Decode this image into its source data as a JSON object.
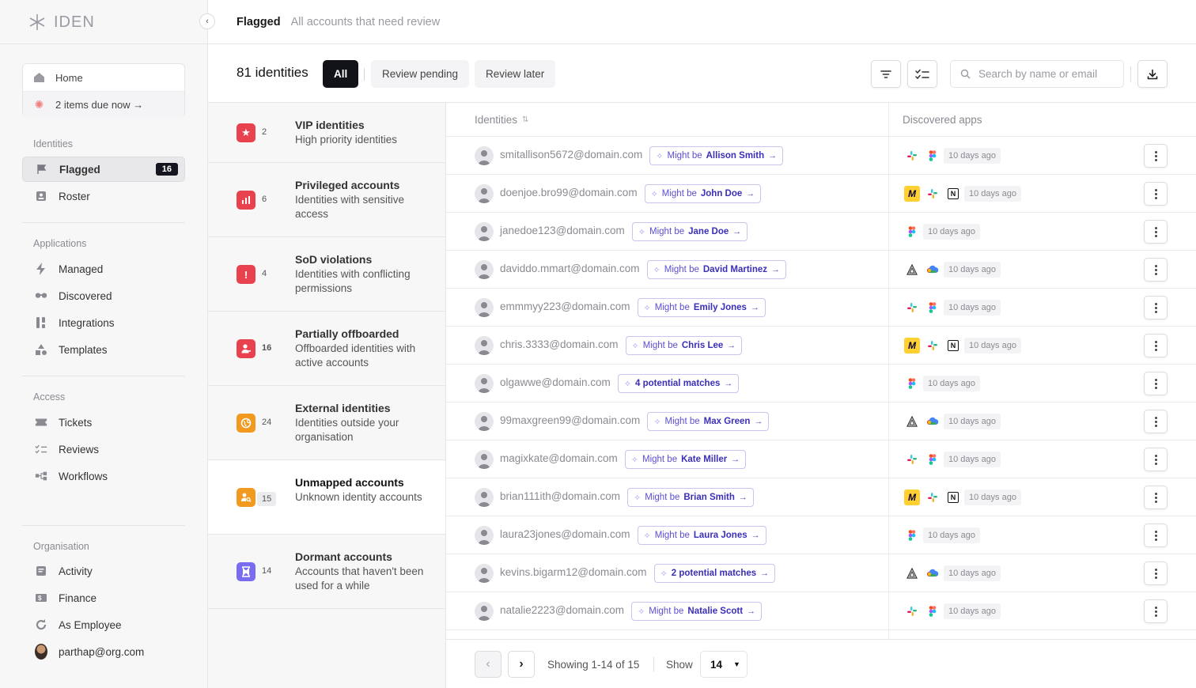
{
  "brand": {
    "name": "IDEN"
  },
  "header": {
    "title": "Flagged",
    "subtitle": "All accounts that need review"
  },
  "quick": {
    "home": "Home",
    "due": "2 items due now →"
  },
  "sidebar": {
    "sections": [
      {
        "label": "Identities",
        "items": [
          {
            "label": "Flagged",
            "badge": "16",
            "icon": "flag-icon"
          },
          {
            "label": "Roster",
            "icon": "roster-icon"
          }
        ]
      },
      {
        "label": "Applications",
        "items": [
          {
            "label": "Managed",
            "icon": "bolt-icon"
          },
          {
            "label": "Discovered",
            "icon": "glasses-icon"
          },
          {
            "label": "Integrations",
            "icon": "integrations-icon"
          },
          {
            "label": "Templates",
            "icon": "shapes-icon"
          }
        ]
      },
      {
        "label": "Access",
        "items": [
          {
            "label": "Tickets",
            "icon": "ticket-icon"
          },
          {
            "label": "Reviews",
            "icon": "checklist-icon"
          },
          {
            "label": "Workflows",
            "icon": "workflow-icon"
          }
        ]
      },
      {
        "label": "Organisation",
        "items": [
          {
            "label": "Activity",
            "icon": "activity-icon"
          },
          {
            "label": "Finance",
            "icon": "finance-icon"
          },
          {
            "label": "As Employee",
            "icon": "refresh-icon"
          },
          {
            "label": "parthap@org.com",
            "icon": "avatar"
          }
        ]
      }
    ]
  },
  "toolbar": {
    "count": "81 identities",
    "tabs": [
      {
        "label": "All"
      },
      {
        "label": "Review pending"
      },
      {
        "label": "Review later"
      }
    ],
    "search_placeholder": "Search by name or email"
  },
  "categories": [
    {
      "count": "2",
      "title": "VIP identities",
      "desc": "High priority identities",
      "color": "#e8424f",
      "icon": "star-icon"
    },
    {
      "count": "6",
      "title": "Privileged accounts",
      "desc": "Identities with sensitive access",
      "color": "#e8424f",
      "icon": "bar-chart-icon"
    },
    {
      "count": "4",
      "title": "SoD violations",
      "desc": "Identities with conflicting permissions",
      "color": "#e8424f",
      "icon": "exclamation-icon"
    },
    {
      "count": "16",
      "title": "Partially offboarded",
      "desc": "Offboarded identities with active accounts",
      "color": "#e8424f",
      "icon": "user-minus-icon"
    },
    {
      "count": "24",
      "title": "External identities",
      "desc": "Identities outside your organisation",
      "color": "#f29a1f",
      "icon": "globe-icon"
    },
    {
      "count": "15",
      "title": "Unmapped accounts",
      "desc": "Unknown identity accounts",
      "color": "#f29a1f",
      "icon": "user-search-icon"
    },
    {
      "count": "14",
      "title": "Dormant accounts",
      "desc": "Accounts that haven't been used for a while",
      "color": "#7a6cf0",
      "icon": "hourglass-icon"
    }
  ],
  "table": {
    "col_identities": "Identities",
    "col_apps": "Discovered apps",
    "rows": [
      {
        "email": "smitallison5672@domain.com",
        "prefix": "Might be",
        "name": "Allison Smith",
        "apps": [
          "slack",
          "figma"
        ],
        "ago": "10 days ago"
      },
      {
        "email": "doenjoe.bro99@domain.com",
        "prefix": "Might be",
        "name": "John Doe",
        "apps": [
          "miro",
          "slack",
          "notion"
        ],
        "ago": "10 days ago"
      },
      {
        "email": "janedoe123@domain.com",
        "prefix": "Might be",
        "name": "Jane Doe",
        "apps": [
          "figma"
        ],
        "ago": "10 days ago"
      },
      {
        "email": "daviddo.mmart@domain.com",
        "prefix": "Might be",
        "name": "David Martinez",
        "apps": [
          "aws",
          "gcp"
        ],
        "ago": "10 days ago"
      },
      {
        "email": "emmmyy223@domain.com",
        "prefix": "Might be",
        "name": "Emily Jones",
        "apps": [
          "slack",
          "figma"
        ],
        "ago": "10 days ago"
      },
      {
        "email": "chris.3333@domain.com",
        "prefix": "Might be",
        "name": "Chris Lee",
        "apps": [
          "miro",
          "slack",
          "notion"
        ],
        "ago": "10 days ago"
      },
      {
        "email": "olgawwe@domain.com",
        "prefix": "",
        "name": "4 potential matches",
        "apps": [
          "figma"
        ],
        "ago": "10 days ago"
      },
      {
        "email": "99maxgreen99@domain.com",
        "prefix": "Might be",
        "name": "Max Green",
        "apps": [
          "aws",
          "gcp"
        ],
        "ago": "10 days ago"
      },
      {
        "email": "magixkate@domain.com",
        "prefix": "Might be",
        "name": "Kate Miller",
        "apps": [
          "slack",
          "figma"
        ],
        "ago": "10 days ago"
      },
      {
        "email": "brian111ith@domain.com",
        "prefix": "Might be",
        "name": "Brian Smith",
        "apps": [
          "miro",
          "slack",
          "notion"
        ],
        "ago": "10 days ago"
      },
      {
        "email": "laura23jones@domain.com",
        "prefix": "Might be",
        "name": "Laura Jones",
        "apps": [
          "figma"
        ],
        "ago": "10 days ago"
      },
      {
        "email": "kevins.bigarm12@domain.com",
        "prefix": "",
        "name": "2 potential matches",
        "apps": [
          "aws",
          "gcp"
        ],
        "ago": "10 days ago"
      },
      {
        "email": "natalie2223@domain.com",
        "prefix": "Might be",
        "name": "Natalie Scott",
        "apps": [
          "slack",
          "figma"
        ],
        "ago": "10 days ago"
      }
    ]
  },
  "footer": {
    "showing": "Showing 1-14 of 15",
    "show_label": "Show",
    "page_size": "14"
  }
}
